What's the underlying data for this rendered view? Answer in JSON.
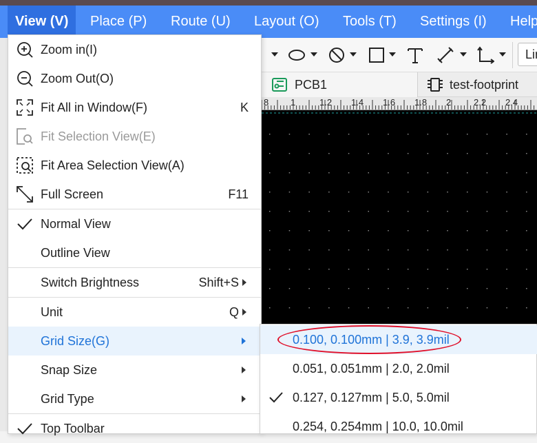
{
  "menubar": {
    "items": [
      "View (V)",
      "Place (P)",
      "Route (U)",
      "Layout (O)",
      "Tools (T)",
      "Settings (I)",
      "Help"
    ]
  },
  "toolbar": {
    "line_select": "Lin",
    "left_partial": "n"
  },
  "tabs": [
    {
      "label": "PCB1",
      "icon": "pcb-icon"
    },
    {
      "label": "test-footprint",
      "icon": "footprint-icon"
    }
  ],
  "ruler": {
    "ticks": [
      "8",
      "1",
      "1.2",
      "1.4",
      "1.6",
      "1.8",
      "2",
      "2.2",
      "2.4"
    ]
  },
  "view_menu": {
    "items": [
      {
        "label": "Zoom in(I)",
        "icon": "zoom-in-icon",
        "shortcut": ""
      },
      {
        "label": "Zoom Out(O)",
        "icon": "zoom-out-icon",
        "shortcut": ""
      },
      {
        "label": "Fit All in Window(F)",
        "icon": "fit-all-icon",
        "shortcut": "K"
      },
      {
        "label": "Fit Selection View(E)",
        "icon": "fit-selection-icon",
        "shortcut": "",
        "disabled": true
      },
      {
        "label": "Fit Area Selection View(A)",
        "icon": "fit-area-icon",
        "shortcut": ""
      },
      {
        "label": "Full Screen",
        "icon": "fullscreen-icon",
        "shortcut": "F11"
      },
      {
        "label": "Normal View",
        "checked": true
      },
      {
        "label": "Outline View"
      },
      {
        "label": "Switch Brightness",
        "shortcut": "Shift+S",
        "submenu": true
      },
      {
        "label": "Unit",
        "shortcut": "Q",
        "submenu": true
      },
      {
        "label": "Grid Size(G)",
        "submenu": true,
        "highlighted": true
      },
      {
        "label": "Snap Size",
        "submenu": true
      },
      {
        "label": "Grid Type",
        "submenu": true
      },
      {
        "label": "Top Toolbar",
        "checked": true
      }
    ]
  },
  "grid_size_submenu": {
    "items": [
      {
        "label": "0.100, 0.100mm | 3.9, 3.9mil",
        "highlighted": true
      },
      {
        "label": "0.051, 0.051mm | 2.0, 2.0mil"
      },
      {
        "label": "0.127, 0.127mm | 5.0, 5.0mil",
        "checked": true
      },
      {
        "label": "0.254, 0.254mm | 10.0, 10.0mil"
      }
    ]
  },
  "colors": {
    "menubar": "#4a8cf7",
    "highlight_text": "#1f73d8",
    "highlight_bg": "#e9f3fd",
    "annotation_oval": "#e0102a",
    "canvas": "#000000"
  }
}
